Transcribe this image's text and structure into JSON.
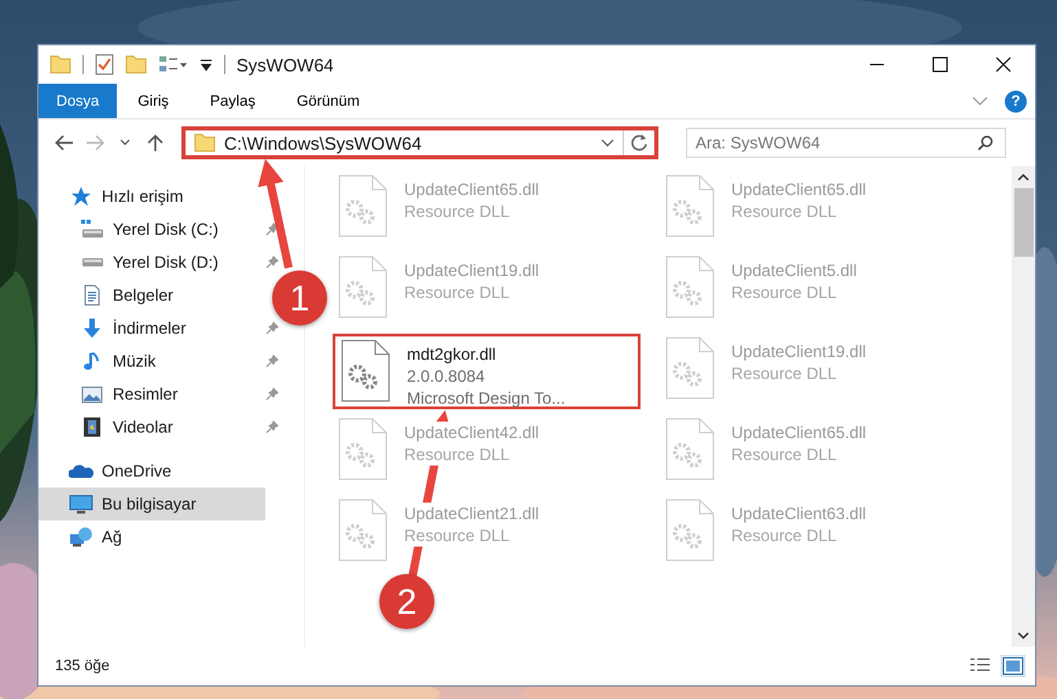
{
  "window": {
    "title": "SysWOW64"
  },
  "help": {
    "label": "?"
  },
  "ribbon_tabs": [
    {
      "label": "Dosya",
      "kind": "file"
    },
    {
      "label": "Giriş",
      "kind": "tab"
    },
    {
      "label": "Paylaş",
      "kind": "tab"
    },
    {
      "label": "Görünüm",
      "kind": "tab"
    }
  ],
  "address": {
    "path": "C:\\Windows\\SysWOW64",
    "highlighted": true
  },
  "search": {
    "placeholder": "Ara: SysWOW64"
  },
  "nav": [
    {
      "label": "Hızlı erişim",
      "kind": "star",
      "selected": false,
      "pinned": false,
      "children": [
        {
          "label": "Yerel Disk (C:)",
          "kind": "sysdrive",
          "selected": false,
          "pinned": true
        },
        {
          "label": "Yerel Disk (D:)",
          "kind": "drive",
          "selected": false,
          "pinned": true
        },
        {
          "label": "Belgeler",
          "kind": "docs",
          "selected": false,
          "pinned": false
        },
        {
          "label": "İndirmeler",
          "kind": "download",
          "selected": false,
          "pinned": true
        },
        {
          "label": "Müzik",
          "kind": "music",
          "selected": false,
          "pinned": true
        },
        {
          "label": "Resimler",
          "kind": "pictures",
          "selected": false,
          "pinned": true
        },
        {
          "label": "Videolar",
          "kind": "video",
          "selected": false,
          "pinned": true
        }
      ]
    },
    {
      "label": "OneDrive",
      "kind": "cloud",
      "selected": false,
      "pinned": false
    },
    {
      "label": "Bu bilgisayar",
      "kind": "pc",
      "selected": true,
      "pinned": false
    },
    {
      "label": "Ağ",
      "kind": "network",
      "selected": false,
      "pinned": false
    }
  ],
  "files": [
    {
      "name": "UpdateClient65.dll",
      "description": "Resource DLL",
      "faded": true,
      "highlighted": false
    },
    {
      "name": "UpdateClient65.dll",
      "description": "Resource DLL",
      "faded": true,
      "highlighted": false
    },
    {
      "name": "UpdateClient19.dll",
      "description": "Resource DLL",
      "faded": true,
      "highlighted": false
    },
    {
      "name": "UpdateClient5.dll",
      "description": "Resource DLL",
      "faded": true,
      "highlighted": false
    },
    {
      "name": "mdt2gkor.dll",
      "version": "2.0.0.8084",
      "description": "Microsoft Design To...",
      "faded": false,
      "highlighted": true
    },
    {
      "name": "UpdateClient19.dll",
      "description": "Resource DLL",
      "faded": true,
      "highlighted": false
    },
    {
      "name": "UpdateClient42.dll",
      "description": "Resource DLL",
      "faded": true,
      "highlighted": false
    },
    {
      "name": "UpdateClient65.dll",
      "description": "Resource DLL",
      "faded": true,
      "highlighted": false
    },
    {
      "name": "UpdateClient21.dll",
      "description": "Resource DLL",
      "faded": true,
      "highlighted": false
    },
    {
      "name": "UpdateClient63.dll",
      "description": "Resource DLL",
      "faded": true,
      "highlighted": false
    }
  ],
  "status_bar": {
    "count": "135 öğe"
  },
  "annotations": [
    {
      "number": "1"
    },
    {
      "number": "2"
    }
  ]
}
